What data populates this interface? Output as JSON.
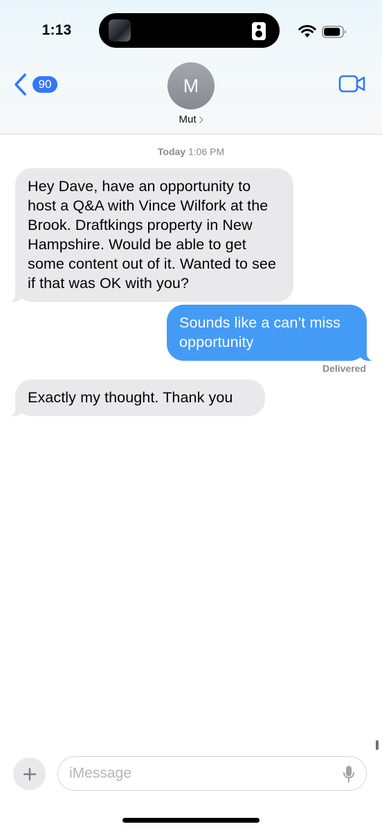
{
  "status_bar": {
    "time": "1:13",
    "wifi_icon": "wifi-icon",
    "battery_icon": "battery-icon"
  },
  "header": {
    "back_badge_count": "90",
    "avatar_initial": "M",
    "contact_name": "Mut",
    "back_icon": "chevron-left-icon",
    "video_icon": "video-camera-icon"
  },
  "conversation": {
    "timestamp_day": "Today",
    "timestamp_time": "1:06 PM",
    "messages": [
      {
        "direction": "incoming",
        "text": "Hey Dave, have an opportunity to host a Q&A with Vince Wilfork at the Brook. Draftkings property in New Hampshire. Would be able to get some content out of it. Wanted to see if that was OK with you?"
      },
      {
        "direction": "outgoing",
        "text": "Sounds like a can’t miss opportunity"
      },
      {
        "direction": "incoming",
        "text": "Exactly my thought. Thank you"
      }
    ],
    "delivered_label": "Delivered"
  },
  "input_bar": {
    "placeholder": "iMessage",
    "value": "",
    "plus_icon": "plus-icon",
    "mic_icon": "microphone-icon"
  },
  "colors": {
    "accent": "#3478f6",
    "outgoing_bubble": "#449bf5",
    "incoming_bubble": "#e9e9eb",
    "meta_text": "#8a8a8e"
  }
}
